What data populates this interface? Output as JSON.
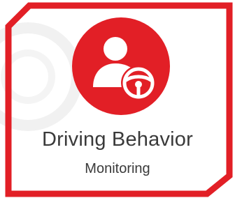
{
  "card": {
    "title": "Driving Behavior",
    "subtitle": "Monitoring",
    "icon": "driver-steering-wheel-icon"
  },
  "colors": {
    "accent": "#e21f26",
    "frame": "#e21f26",
    "text": "#3a3a3a",
    "icon_fg": "#ffffff",
    "background": "#ffffff",
    "watermark": "#f1f1f1"
  }
}
